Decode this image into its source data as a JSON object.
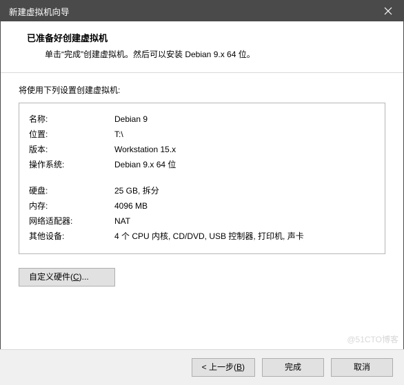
{
  "titlebar": {
    "title": "新建虚拟机向导"
  },
  "header": {
    "title": "已准备好创建虚拟机",
    "subtitle": "单击“完成”创建虚拟机。然后可以安装 Debian 9.x 64 位。"
  },
  "content": {
    "lead": "将使用下列设置创建虚拟机:",
    "rows1": [
      {
        "label": "名称:",
        "value": "Debian 9"
      },
      {
        "label": "位置:",
        "value": "T:\\"
      },
      {
        "label": "版本:",
        "value": "Workstation 15.x"
      },
      {
        "label": "操作系统:",
        "value": "Debian 9.x 64 位"
      }
    ],
    "rows2": [
      {
        "label": "硬盘:",
        "value": "25 GB, 拆分"
      },
      {
        "label": "内存:",
        "value": "4096 MB"
      },
      {
        "label": "网络适配器:",
        "value": "NAT"
      },
      {
        "label": "其他设备:",
        "value": "4 个 CPU 内核, CD/DVD, USB 控制器, 打印机, 声卡"
      }
    ],
    "customize_prefix": "自定义硬件(",
    "customize_hotkey": "C",
    "customize_suffix": ")..."
  },
  "footer": {
    "back_prefix": "< 上一步(",
    "back_hotkey": "B",
    "back_suffix": ")",
    "finish": "完成",
    "cancel": "取消"
  },
  "watermark": "@51CTO博客"
}
